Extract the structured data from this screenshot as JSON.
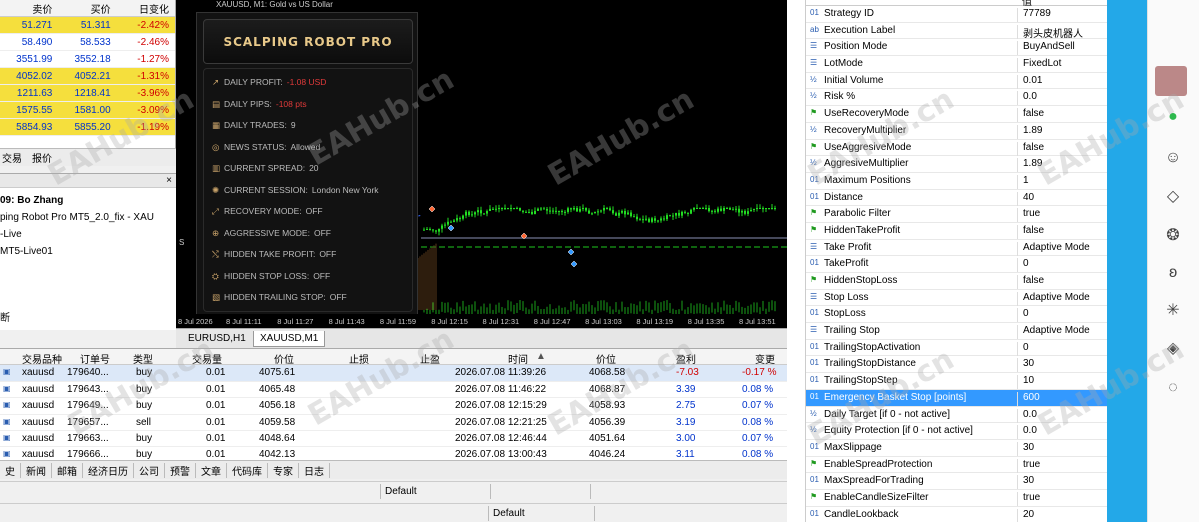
{
  "quotes": {
    "headers": [
      "卖价",
      "买价",
      "日变化"
    ],
    "rows": [
      {
        "bid": "51.271",
        "ask": "51.311",
        "change": "-2.42%",
        "hl": "y"
      },
      {
        "bid": "58.490",
        "ask": "58.533",
        "change": "-2.46%",
        "hl": "g"
      },
      {
        "bid": "3551.99",
        "ask": "3552.18",
        "change": "-1.27%",
        "hl": "g"
      },
      {
        "bid": "4052.02",
        "ask": "4052.21",
        "change": "-1.31%",
        "hl": "y"
      },
      {
        "bid": "1211.63",
        "ask": "1218.41",
        "change": "-3.96%",
        "hl": "y"
      },
      {
        "bid": "1575.55",
        "ask": "1581.00",
        "change": "-3.09%",
        "hl": "y"
      },
      {
        "bid": "5854.93",
        "ask": "5855.20",
        "change": "-1.19%",
        "hl": "y"
      }
    ],
    "tabs": [
      "交易",
      "报价"
    ]
  },
  "navigator": {
    "lines": [
      "09: Bo Zhang",
      "ping Robot Pro MT5_2.0_fix - XAU",
      "-Live",
      "MT5-Live01",
      "断"
    ]
  },
  "chart": {
    "title": "XAUUSD, M1:  Gold vs US Dollar",
    "price_marker": "S",
    "robot": {
      "brand": "SCALPING ROBOT PRO",
      "stats": [
        {
          "label": "DAILY PROFIT:",
          "value": "-1.08 USD",
          "color": "#e03a3a",
          "icon": "↗"
        },
        {
          "label": "DAILY PIPS:",
          "value": "-108 pts",
          "color": "#e03a3a",
          "icon": "▤"
        },
        {
          "label": "DAILY TRADES:",
          "value": "9",
          "color": "#bbbbbb",
          "icon": "▦"
        },
        {
          "label": "NEWS STATUS:",
          "value": "Allowed",
          "color": "#bbbbbb",
          "icon": "◎"
        },
        {
          "label": "CURRENT SPREAD:",
          "value": "20",
          "color": "#bbbbbb",
          "icon": "▥"
        },
        {
          "label": "CURRENT SESSION:",
          "value": "London New York",
          "color": "#bbbbbb",
          "icon": "✺"
        },
        {
          "label": "RECOVERY MODE:",
          "value": "OFF",
          "color": "#bbbbbb",
          "icon": "⤢"
        },
        {
          "label": "AGGRESSIVE MODE:",
          "value": "OFF",
          "color": "#bbbbbb",
          "icon": "⊕"
        },
        {
          "label": "HIDDEN TAKE PROFIT:",
          "value": "OFF",
          "color": "#bbbbbb",
          "icon": "⤭"
        },
        {
          "label": "HIDDEN STOP LOSS:",
          "value": "OFF",
          "color": "#bbbbbb",
          "icon": "⛭"
        },
        {
          "label": "HIDDEN TRAILING STOP:",
          "value": "OFF",
          "color": "#bbbbbb",
          "icon": "▧"
        }
      ]
    },
    "xaxis": [
      "8 Jul 2026",
      "8 Jul 11:11",
      "8 Jul 11:27",
      "8 Jul 11:43",
      "8 Jul 11:59",
      "8 Jul 12:15",
      "8 Jul 12:31",
      "8 Jul 12:47",
      "8 Jul 13:03",
      "8 Jul 13:19",
      "8 Jul 13:35",
      "8 Jul 13:51"
    ],
    "tabs": [
      "EURUSD,H1",
      "XAUUSD,M1"
    ]
  },
  "trades": {
    "headers": [
      "交易品种",
      "订单号",
      "类型",
      "交易量",
      "价位",
      "止损",
      "止盈",
      "时间",
      "价位",
      "盈利",
      "变更"
    ],
    "rows": [
      {
        "symbol": "xauusd",
        "order": "179640...",
        "type": "buy",
        "volume": "0.01",
        "price": "4075.61",
        "sl": "",
        "tp": "",
        "time": "2026.07.08 11:39:26",
        "cur": "4068.58",
        "profit": "-7.03",
        "change": "-0.17 %",
        "pclass": "red"
      },
      {
        "symbol": "xauusd",
        "order": "179643...",
        "type": "buy",
        "volume": "0.01",
        "price": "4065.48",
        "sl": "",
        "tp": "",
        "time": "2026.07.08 11:46:22",
        "cur": "4068.87",
        "profit": "3.39",
        "change": "0.08 %",
        "pclass": "blue"
      },
      {
        "symbol": "xauusd",
        "order": "179649...",
        "type": "buy",
        "volume": "0.01",
        "price": "4056.18",
        "sl": "",
        "tp": "",
        "time": "2026.07.08 12:15:29",
        "cur": "4058.93",
        "profit": "2.75",
        "change": "0.07 %",
        "pclass": "blue"
      },
      {
        "symbol": "xauusd",
        "order": "179657...",
        "type": "sell",
        "volume": "0.01",
        "price": "4059.58",
        "sl": "",
        "tp": "",
        "time": "2026.07.08 12:21:25",
        "cur": "4056.39",
        "profit": "3.19",
        "change": "0.08 %",
        "pclass": "blue"
      },
      {
        "symbol": "xauusd",
        "order": "179663...",
        "type": "buy",
        "volume": "0.01",
        "price": "4048.64",
        "sl": "",
        "tp": "",
        "time": "2026.07.08 12:46:44",
        "cur": "4051.64",
        "profit": "3.00",
        "change": "0.07 %",
        "pclass": "blue"
      },
      {
        "symbol": "xauusd",
        "order": "179666...",
        "type": "buy",
        "volume": "0.01",
        "price": "4042.13",
        "sl": "",
        "tp": "",
        "time": "2026.07.08 13:00:43",
        "cur": "4046.24",
        "profit": "3.11",
        "change": "0.08 %",
        "pclass": "blue"
      }
    ]
  },
  "bottom_tabs": [
    "史",
    "新闻",
    "邮箱",
    "经济日历",
    "公司",
    "预警",
    "文章",
    "代码库",
    "专家",
    "日志"
  ],
  "status": {
    "line1": "Default",
    "line2": "Default"
  },
  "inputs": {
    "header_value": "值",
    "rows": [
      {
        "icon": "01",
        "name": "Strategy ID",
        "value": "77789"
      },
      {
        "icon": "ab",
        "name": "Execution Label",
        "value": "剥头皮机器人"
      },
      {
        "icon": "☰",
        "name": "Position Mode",
        "value": "BuyAndSell"
      },
      {
        "icon": "☰",
        "name": "LotMode",
        "value": "FixedLot"
      },
      {
        "icon": "½",
        "name": "Initial Volume",
        "value": "0.01"
      },
      {
        "icon": "½",
        "name": "Risk %",
        "value": "0.0"
      },
      {
        "icon": "⚑",
        "name": "UseRecoveryMode",
        "value": "false"
      },
      {
        "icon": "½",
        "name": "RecoveryMultiplier",
        "value": "1.89"
      },
      {
        "icon": "⚑",
        "name": "UseAggresiveMode",
        "value": "false"
      },
      {
        "icon": "½",
        "name": "AggresiveMultiplier",
        "value": "1.89"
      },
      {
        "icon": "01",
        "name": "Maximum Positions",
        "value": "1"
      },
      {
        "icon": "01",
        "name": "Distance",
        "value": "40"
      },
      {
        "icon": "⚑",
        "name": "Parabolic Filter",
        "value": "true"
      },
      {
        "icon": "⚑",
        "name": "HiddenTakeProfit",
        "value": "false"
      },
      {
        "icon": "☰",
        "name": "Take Profit",
        "value": "Adaptive Mode"
      },
      {
        "icon": "01",
        "name": "TakeProfit",
        "value": "0"
      },
      {
        "icon": "⚑",
        "name": "HiddenStopLoss",
        "value": "false"
      },
      {
        "icon": "☰",
        "name": "Stop Loss",
        "value": "Adaptive Mode"
      },
      {
        "icon": "01",
        "name": "StopLoss",
        "value": "0"
      },
      {
        "icon": "☰",
        "name": "Trailing Stop",
        "value": "Adaptive Mode"
      },
      {
        "icon": "01",
        "name": "TrailingStopActivation",
        "value": "0"
      },
      {
        "icon": "01",
        "name": "TrailingStopDistance",
        "value": "30"
      },
      {
        "icon": "01",
        "name": "TrailingStopStep",
        "value": "10"
      },
      {
        "icon": "01",
        "name": "Emergency Basket Stop [points]",
        "value": "600",
        "selected": true
      },
      {
        "icon": "½",
        "name": "Daily Target [if 0 - not active]",
        "value": "0.0"
      },
      {
        "icon": "½",
        "name": "Equity Protection [if 0 - not active]",
        "value": "0.0"
      },
      {
        "icon": "01",
        "name": "MaxSlippage",
        "value": "30"
      },
      {
        "icon": "⚑",
        "name": "EnableSpreadProtection",
        "value": "true"
      },
      {
        "icon": "01",
        "name": "MaxSpreadForTrading",
        "value": "30"
      },
      {
        "icon": "⚑",
        "name": "EnableCandleSizeFilter",
        "value": "true"
      },
      {
        "icon": "01",
        "name": "CandleLookback",
        "value": "20"
      }
    ]
  },
  "watermark": "EAHub.cn",
  "colors": {
    "accent": "#3399ff",
    "sidebar": "#23a8e8",
    "quote_highlight": "#f5df3d",
    "candle": "#22dd22"
  }
}
